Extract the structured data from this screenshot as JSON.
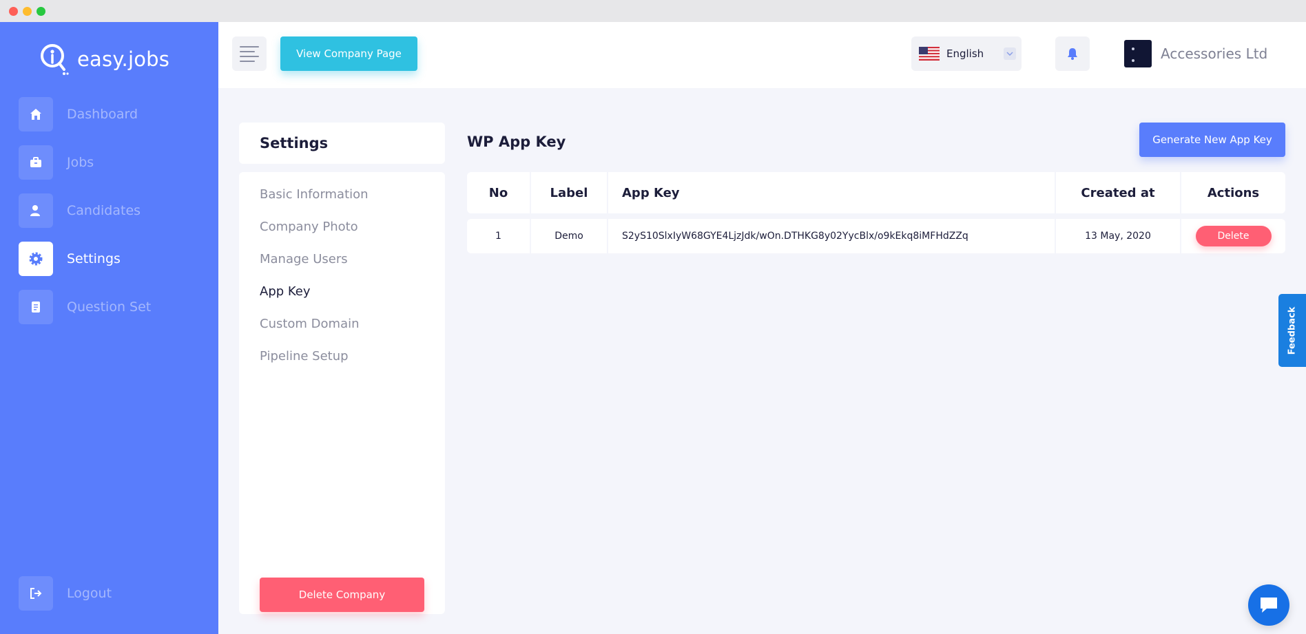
{
  "app": {
    "logo_text": "easy.jobs"
  },
  "sidebar": {
    "items": [
      {
        "label": "Dashboard",
        "icon": "home-icon"
      },
      {
        "label": "Jobs",
        "icon": "briefcase-icon"
      },
      {
        "label": "Candidates",
        "icon": "user-icon"
      },
      {
        "label": "Settings",
        "icon": "gear-icon",
        "active": true
      },
      {
        "label": "Question Set",
        "icon": "document-icon"
      }
    ],
    "logout_label": "Logout"
  },
  "header": {
    "view_company_label": "View Company Page",
    "language": "English",
    "company_name": "Accessories Ltd"
  },
  "settings": {
    "title": "Settings",
    "menu": [
      {
        "label": "Basic Information"
      },
      {
        "label": "Company Photo"
      },
      {
        "label": "Manage Users"
      },
      {
        "label": "App Key",
        "active": true
      },
      {
        "label": "Custom Domain"
      },
      {
        "label": "Pipeline Setup"
      }
    ],
    "delete_company_label": "Delete Company"
  },
  "main": {
    "title": "WP App Key",
    "generate_label": "Generate New App Key",
    "table": {
      "columns": [
        "No",
        "Label",
        "App Key",
        "Created at",
        "Actions"
      ],
      "rows": [
        {
          "no": "1",
          "label": "Demo",
          "app_key": "S2yS10SlxIyW68GYE4LjzJdk/wOn.DTHKG8y02YycBlx/o9kEkq8iMFHdZZq",
          "created_at": "13 May, 2020",
          "action_label": "Delete"
        }
      ]
    }
  },
  "widgets": {
    "feedback_label": "Feedback"
  },
  "colors": {
    "sidebar": "#597dfc",
    "accent_cyan": "#2fc1e1",
    "danger": "#ff5f74",
    "text_dark": "#1c1d3a",
    "feedback": "#1a7fe0"
  }
}
